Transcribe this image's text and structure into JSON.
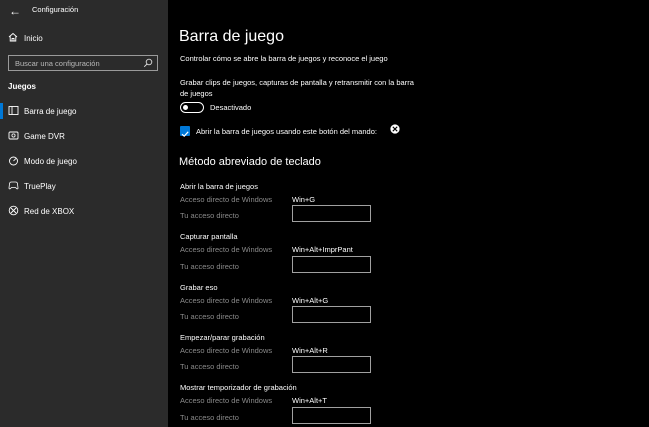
{
  "window": {
    "title": "Configuración"
  },
  "sidebar": {
    "home_label": "Inicio",
    "search_placeholder": "Buscar una configuración",
    "section_title": "Juegos",
    "items": [
      {
        "label": "Barra de juego",
        "icon": "game-bar-icon",
        "selected": true
      },
      {
        "label": "Game DVR",
        "icon": "game-dvr-icon",
        "selected": false
      },
      {
        "label": "Modo de juego",
        "icon": "game-mode-icon",
        "selected": false
      },
      {
        "label": "TruePlay",
        "icon": "trueplay-icon",
        "selected": false
      },
      {
        "label": "Red de XBOX",
        "icon": "xbox-icon",
        "selected": false
      }
    ]
  },
  "main": {
    "title": "Barra de juego",
    "subtitle": "Controlar cómo se abre la barra de juegos y reconoce el juego",
    "record_description": "Grabar clips de juegos, capturas de pantalla y retransmitir con la barra de juegos",
    "toggle": {
      "label": "Desactivado",
      "on": false
    },
    "checkbox": {
      "label": "Abrir la barra de juegos usando este botón del mando:",
      "checked": true
    },
    "shortcuts_heading": "Método abreviado de teclado",
    "windows_shortcut_label": "Acceso directo de Windows",
    "your_shortcut_label": "Tu acceso directo",
    "groups": [
      {
        "title": "Abrir la barra de juegos",
        "windows_shortcut": "Win+G",
        "custom_shortcut": ""
      },
      {
        "title": "Capturar pantalla",
        "windows_shortcut": "Win+Alt+ImprPant",
        "custom_shortcut": ""
      },
      {
        "title": "Grabar eso",
        "windows_shortcut": "Win+Alt+G",
        "custom_shortcut": ""
      },
      {
        "title": "Empezar/parar grabación",
        "windows_shortcut": "Win+Alt+R",
        "custom_shortcut": ""
      },
      {
        "title": "Mostrar temporizador de grabación",
        "windows_shortcut": "Win+Alt+T",
        "custom_shortcut": ""
      }
    ]
  },
  "colors": {
    "accent": "#0078d7",
    "sidebar_bg": "#2b2b2b",
    "main_bg": "#000000"
  }
}
